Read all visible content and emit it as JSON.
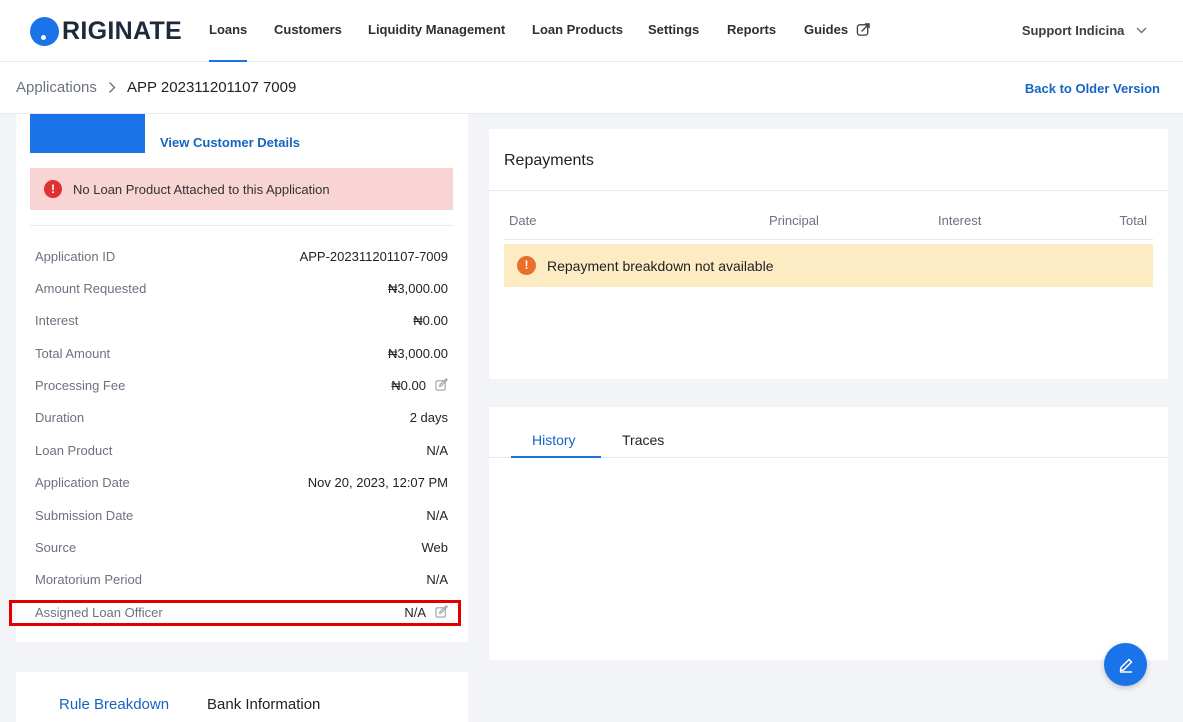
{
  "brand": {
    "logo_text": "RIGINATE",
    "accent": "#1a73e8"
  },
  "nav": {
    "items": [
      {
        "label": "Loans",
        "active": true
      },
      {
        "label": "Customers"
      },
      {
        "label": "Liquidity Management"
      },
      {
        "label": "Loan Products"
      },
      {
        "label": "Settings"
      },
      {
        "label": "Reports"
      },
      {
        "label": "Guides",
        "icon": "external-link-icon"
      }
    ],
    "user": "Support Indicina"
  },
  "breadcrumb": {
    "root": "Applications",
    "current": "APP 202311201107 7009",
    "back_link": "Back to Older Version"
  },
  "customer": {
    "view_details": "View Customer Details"
  },
  "alerts": {
    "no_product": "No Loan Product Attached to this Application",
    "no_repayment": "Repayment breakdown not available"
  },
  "details": [
    {
      "key": "Application ID",
      "value": "APP-202311201107-7009"
    },
    {
      "key": "Amount Requested",
      "value": "₦3,000.00"
    },
    {
      "key": "Interest",
      "value": "₦0.00"
    },
    {
      "key": "Total Amount",
      "value": "₦3,000.00"
    },
    {
      "key": "Processing Fee",
      "value": "₦0.00",
      "editable": true
    },
    {
      "key": "Duration",
      "value": "2 days"
    },
    {
      "key": "Loan Product",
      "value": "N/A"
    },
    {
      "key": "Application Date",
      "value": "Nov 20, 2023, 12:07 PM"
    },
    {
      "key": "Submission Date",
      "value": "N/A"
    },
    {
      "key": "Source",
      "value": "Web"
    },
    {
      "key": "Moratorium Period",
      "value": "N/A"
    },
    {
      "key": "Assigned Loan Officer",
      "value": "N/A",
      "editable": true
    }
  ],
  "left_tabs": {
    "rule_breakdown": "Rule Breakdown",
    "bank_information": "Bank Information"
  },
  "repayments": {
    "title": "Repayments",
    "columns": {
      "date": "Date",
      "principal": "Principal",
      "interest": "Interest",
      "total": "Total"
    }
  },
  "history_tabs": {
    "history": "History",
    "traces": "Traces"
  }
}
